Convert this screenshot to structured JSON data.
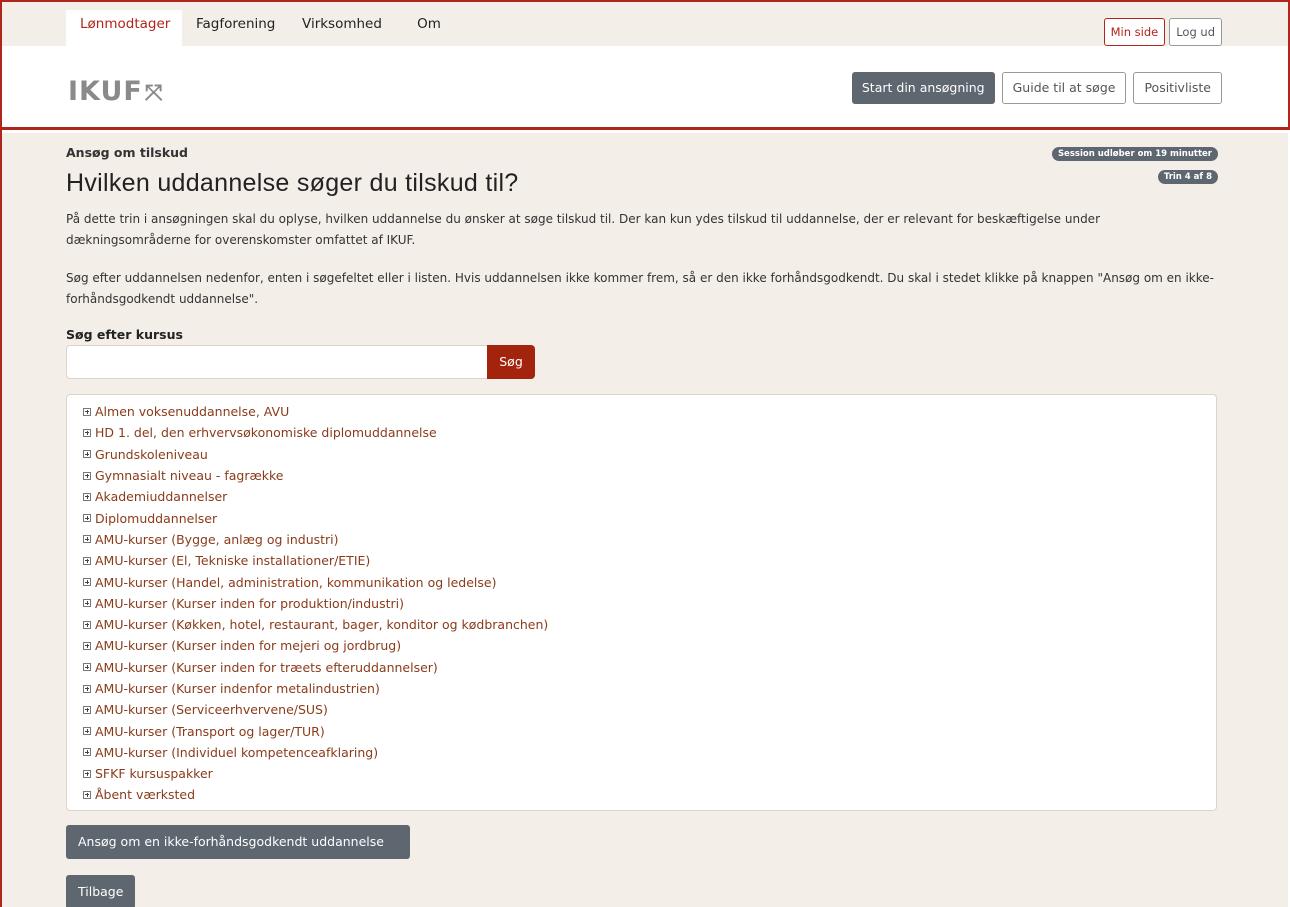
{
  "topnav": {
    "tabs": [
      {
        "label": "Lønmodtager",
        "active": true
      },
      {
        "label": "Fagforening",
        "active": false
      },
      {
        "label": "Virksomhed",
        "active": false
      },
      {
        "label": "Om IKUF",
        "active": false
      }
    ],
    "min_side": "Min side",
    "log_ud": "Log ud"
  },
  "header": {
    "logo_text": "IKUF",
    "logo_mark": "⤧",
    "buttons": {
      "start": "Start din ansøgning",
      "guide": "Guide til at søge",
      "positiv": "Positivliste"
    }
  },
  "page": {
    "breadcrumb": "Ansøg om tilskud",
    "session_badge": "Session udløber om 19 minutter",
    "step_badge": "Trin 4 af 8",
    "title": "Hvilken uddannelse søger du tilskud til?",
    "intro1": "På dette trin i ansøgningen skal du oplyse, hvilken uddannelse du ønsker at søge tilskud til. Der kan kun ydes tilskud til uddannelse, der er relevant for beskæftigelse under dækningsområderne for overenskomster omfattet af IKUF.",
    "intro2": "Søg efter uddannelsen nedenfor, enten i søgefeltet eller i listen. Hvis uddannelsen ikke kommer frem, så er den ikke forhåndsgodkendt. Du skal i stedet klikke på knappen \"Ansøg om en ikke-forhåndsgodkendt uddannelse\".",
    "search": {
      "label": "Søg efter kursus",
      "value": "",
      "placeholder": "",
      "button": "Søg"
    },
    "tree_items": [
      "Almen voksenuddannelse, AVU",
      "HD 1. del, den erhvervsøkonomiske diplomuddannelse",
      "Grundskoleniveau",
      "Gymnasialt niveau - fagrække",
      "Akademiuddannelser",
      "Diplomuddannelser",
      "AMU-kurser (Bygge, anlæg og industri)",
      "AMU-kurser (El, Tekniske installationer/ETIE)",
      "AMU-kurser (Handel, administration, kommunikation og ledelse)",
      "AMU-kurser (Kurser inden for produktion/industri)",
      "AMU-kurser (Køkken, hotel, restaurant, bager, konditor og kødbranchen)",
      "AMU-kurser (Kurser inden for mejeri og jordbrug)",
      "AMU-kurser (Kurser inden for træets efteruddannelser)",
      "AMU-kurser (Kurser indenfor metalindustrien)",
      "AMU-kurser (Serviceerhvervene/SUS)",
      "AMU-kurser (Transport og lager/TUR)",
      "AMU-kurser (Individuel kompetenceafklaring)",
      "SFKF kursuspakker",
      "Åbent værksted"
    ],
    "btn_ansog": "Ansøg om en ikke-forhåndsgodkendt uddannelse",
    "btn_tilbage": "Tilbage"
  },
  "colors": {
    "accent": "#b1251b",
    "search_button": "#a3230d",
    "gray_button": "#5e6670",
    "background": "#f4eee9",
    "link": "#8a3b1a"
  }
}
